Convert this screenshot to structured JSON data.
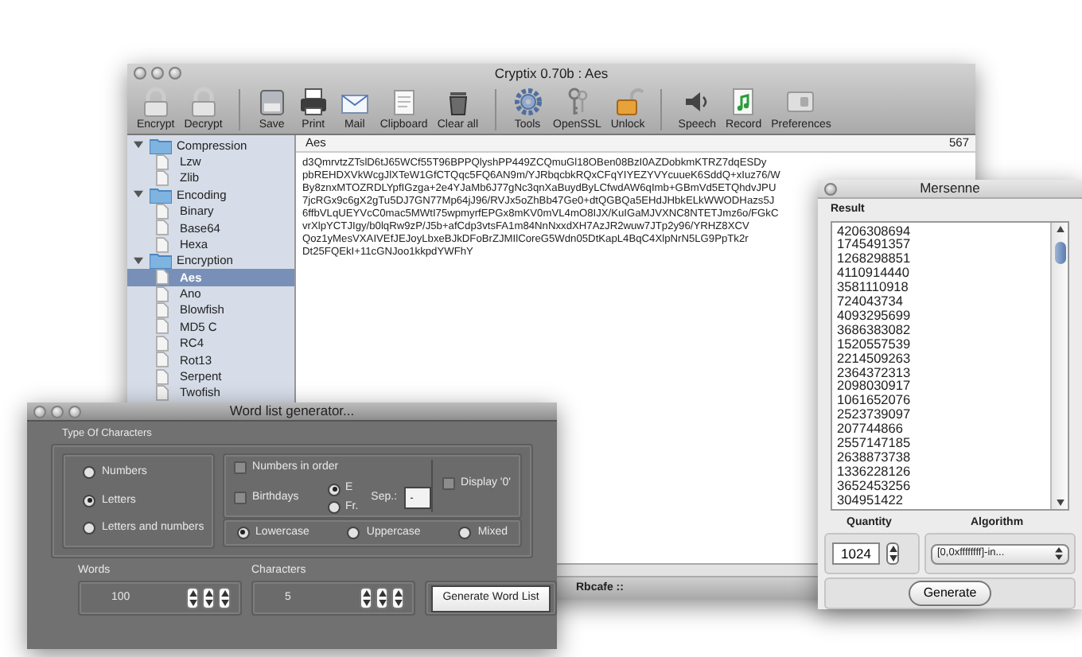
{
  "main_window": {
    "title": "Cryptix 0.70b : Aes",
    "toolbar": [
      [
        {
          "label": "Encrypt",
          "kind": "lock"
        },
        {
          "label": "Decrypt",
          "kind": "lock"
        }
      ],
      [
        {
          "label": "Save",
          "kind": "disk"
        },
        {
          "label": "Print",
          "kind": "printer"
        },
        {
          "label": "Mail",
          "kind": "envelope"
        },
        {
          "label": "Clipboard",
          "kind": "document"
        },
        {
          "label": "Clear all",
          "kind": "trash"
        }
      ],
      [
        {
          "label": "Tools",
          "kind": "gear"
        },
        {
          "label": "OpenSSL",
          "kind": "keys"
        },
        {
          "label": "Unlock",
          "kind": "padlock"
        }
      ],
      [
        {
          "label": "Speech",
          "kind": "speaker"
        },
        {
          "label": "Record",
          "kind": "musicfile"
        },
        {
          "label": "Preferences",
          "kind": "panel"
        }
      ]
    ],
    "sidebar": [
      {
        "label": "Compression",
        "expanded": true,
        "children": [
          {
            "label": "Lzw",
            "selected": false
          },
          {
            "label": "Zlib",
            "selected": false
          }
        ]
      },
      {
        "label": "Encoding",
        "expanded": true,
        "children": [
          {
            "label": "Binary",
            "selected": false
          },
          {
            "label": "Base64",
            "selected": false
          },
          {
            "label": "Hexa",
            "selected": false
          }
        ]
      },
      {
        "label": "Encryption",
        "expanded": true,
        "children": [
          {
            "label": "Aes",
            "selected": true
          },
          {
            "label": "Ano",
            "selected": false
          },
          {
            "label": "Blowfish",
            "selected": false
          },
          {
            "label": "MD5 C",
            "selected": false
          },
          {
            "label": "RC4",
            "selected": false
          },
          {
            "label": "Rot13",
            "selected": false
          },
          {
            "label": "Serpent",
            "selected": false
          },
          {
            "label": "Twofish",
            "selected": false
          }
        ]
      }
    ],
    "content": {
      "title": "Aes",
      "count": "567",
      "lines": [
        "d3QmrvtzZTslD6tJ65WCf55T96BPPQlyshPP449ZCQmuGl18OBen08BzI0AZDobkmKTRZ7dqESDy",
        "pbREHDXVkWcgJlXTeW1GfCTQqc5FQ6AN9m/YJRbqcbkRQxCFqYIYEZYVYcuueK6SddQ+xIuz76/W",
        "By8znxMTOZRDLYpfIGzga+2e4YJaMb6J77gNc3qnXaBuydByLCfwdAW6qImb+GBmVd5ETQhdvJPU",
        "7jcRGx9c6gX2gTu5DJ7GN77Mp64jJ96/RVJx5oZhBb47Ge0+dtQGBQa5EHdJHbkELkWWODHazs5J",
        "6ffbVLqUEYVcC0mac5MWtI75wpmyrfEPGx8mKV0mVL4mO8IJX/KuIGaMJVXNC8NTETJmz6o/FGkC",
        "vrXlpYCTJIgy/b0lqRw9zP/J5b+afCdp3vtsFA1m84NnNxxdXH7AzJR2wuw7JTp2y96/YRHZ8XCV",
        "Qoz1yMesVXAIVEfJEJoyLbxeBJkDFoBrZJMIlCoreG5Wdn05DtKapL4BqC4XlpNrN5LG9PpTk2r",
        "Dt25FQEkI+11cGNJoo1kkpdYWFhY"
      ]
    },
    "status_bar": "Rbcafe ::"
  },
  "mersenne_window": {
    "title": "Mersenne",
    "result_label": "Result",
    "results": [
      "4206308694",
      "1745491357",
      "1268298851",
      "4110914440",
      "3581110918",
      "724043734",
      "4093295699",
      "3686383082",
      "1520557539",
      "2214509263",
      "2364372313",
      "2098030917",
      "1061652076",
      "2523739097",
      "207744866",
      "2557147185",
      "2638873738",
      "1336228126",
      "3652453256",
      "304951422"
    ],
    "quantity_label": "Quantity",
    "quantity": "1024",
    "algorithm_label": "Algorithm",
    "algorithm": "[0,0xffffffff]-in...",
    "generate_button": "Generate"
  },
  "word_list_window": {
    "title": "Word list generator...",
    "type_label": "Type Of Characters",
    "character_types": [
      {
        "label": "Numbers",
        "selected": false
      },
      {
        "label": "Letters",
        "selected": true
      },
      {
        "label": "Letters and numbers",
        "selected": false
      }
    ],
    "numbers_in_order": {
      "label": "Numbers in order",
      "checked": false
    },
    "birthdays": {
      "label": "Birthdays",
      "checked": false
    },
    "date_formats": [
      {
        "label": "E",
        "selected": true
      },
      {
        "label": "Fr.",
        "selected": false
      }
    ],
    "separator_label": "Sep.:",
    "separator": "-",
    "display_zero": {
      "label": "Display '0'",
      "checked": false
    },
    "cases": [
      {
        "label": "Lowercase",
        "selected": true
      },
      {
        "label": "Uppercase",
        "selected": false
      },
      {
        "label": "Mixed",
        "selected": false
      }
    ],
    "words_label": "Words",
    "words": "100",
    "characters_label": "Characters",
    "characters": "5",
    "generate_button": "Generate Word List"
  }
}
